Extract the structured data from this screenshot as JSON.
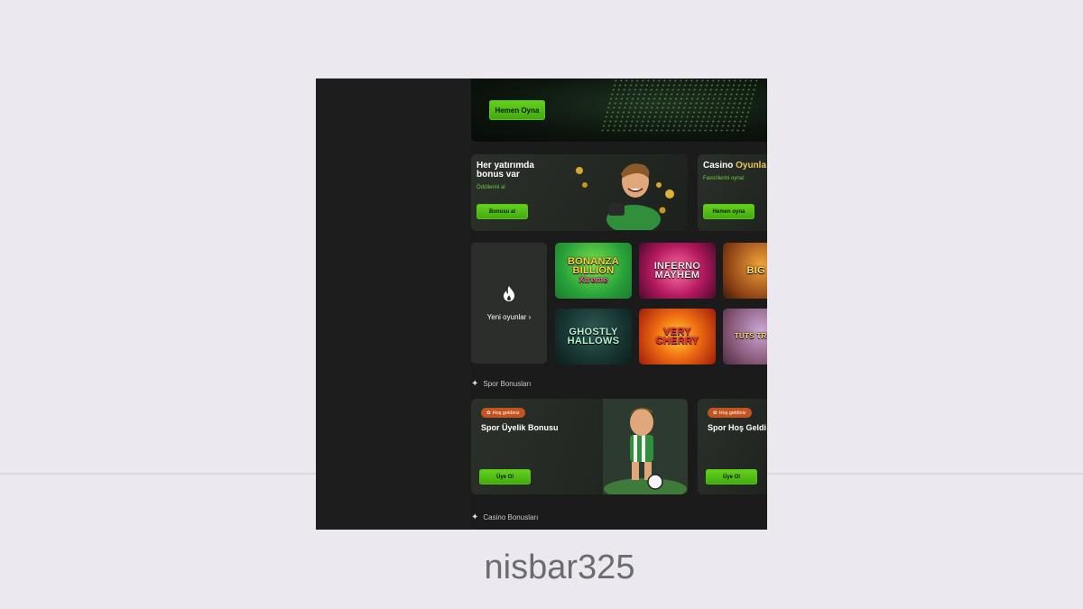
{
  "hero": {
    "button": "Hemen Oyna"
  },
  "promos": [
    {
      "title_line1": "Her yatırımda",
      "title_line2": "bonus var",
      "subtitle": "Ödüllerini al",
      "button": "Bonusu al"
    },
    {
      "title_a": "Casino ",
      "title_b": "Oyunla",
      "subtitle": "Favorilerini oyna!",
      "button": "Hemen oyna"
    }
  ],
  "new_games": {
    "label": "Yeni oyunlar",
    "chevron": "›",
    "icon": "flame-icon"
  },
  "games": [
    {
      "name": "BONANZA BILLION Xtreme",
      "line1": "BONANZA",
      "line2": "BILLION",
      "line3": "Xtreme"
    },
    {
      "name": "INFERNO MAYHEM",
      "line1": "INFERNO",
      "line2": "MAYHEM"
    },
    {
      "name": "BIG BASS",
      "line1": "BIG B"
    },
    {
      "name": "GHOSTLY HALLOWS",
      "line1": "GHOSTLY",
      "line2": "HALLOWS"
    },
    {
      "name": "VERY CHERRY",
      "line1": "VERY",
      "line2": "CHERRY"
    },
    {
      "name": "TUT'S TREASURE",
      "line1": "TUTS TREASU"
    }
  ],
  "sections": {
    "sports": "Spor Bonusları",
    "casino": "Casino Bonusları"
  },
  "sport_cards": [
    {
      "badge": "Hoş geldiniz",
      "title": "Spor Üyelik Bonusu",
      "button": "Üye Ol",
      "info": "i"
    },
    {
      "badge": "Hoş geldiniz",
      "title": "Spor Hoş Geldi",
      "button": "Üye Ol"
    }
  ],
  "caption": "nisbar325",
  "colors": {
    "accent_green": "#4fbf14",
    "badge_orange": "#c5531f",
    "background": "#1a1b1a"
  }
}
